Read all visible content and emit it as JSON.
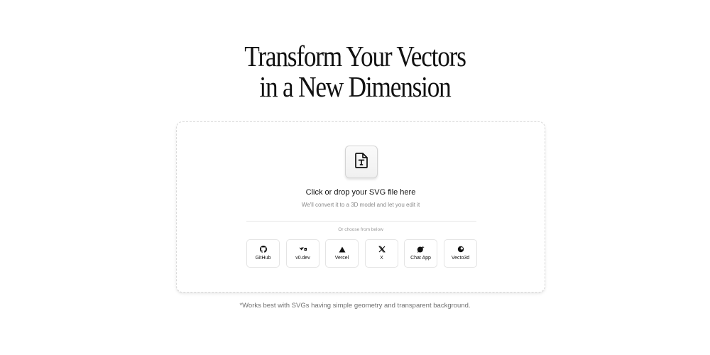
{
  "hero": {
    "title_line1": "Transform Your Vectors",
    "title_line2": "in a New Dimension"
  },
  "dropzone": {
    "icon": "file-text-icon",
    "title": "Click or drop your SVG file here",
    "subtitle": "We'll convert it to a 3D model and let you edit it",
    "choose_label": "Or choose from below"
  },
  "sources": [
    {
      "label": "GitHub",
      "icon": "github-icon"
    },
    {
      "label": "v0.dev",
      "icon": "v0-icon"
    },
    {
      "label": "Vercel",
      "icon": "vercel-triangle-icon"
    },
    {
      "label": "X",
      "icon": "x-logo-icon"
    },
    {
      "label": "Chat App",
      "icon": "chat-app-icon"
    },
    {
      "label": "Vecto3d",
      "icon": "vecto3d-icon"
    }
  ],
  "footnote": "*Works best with SVGs having simple geometry and transparent background.",
  "colors": {
    "background": "#ffffff",
    "text": "#111111",
    "muted": "#8a8a8a",
    "border": "#e4e4e4"
  }
}
